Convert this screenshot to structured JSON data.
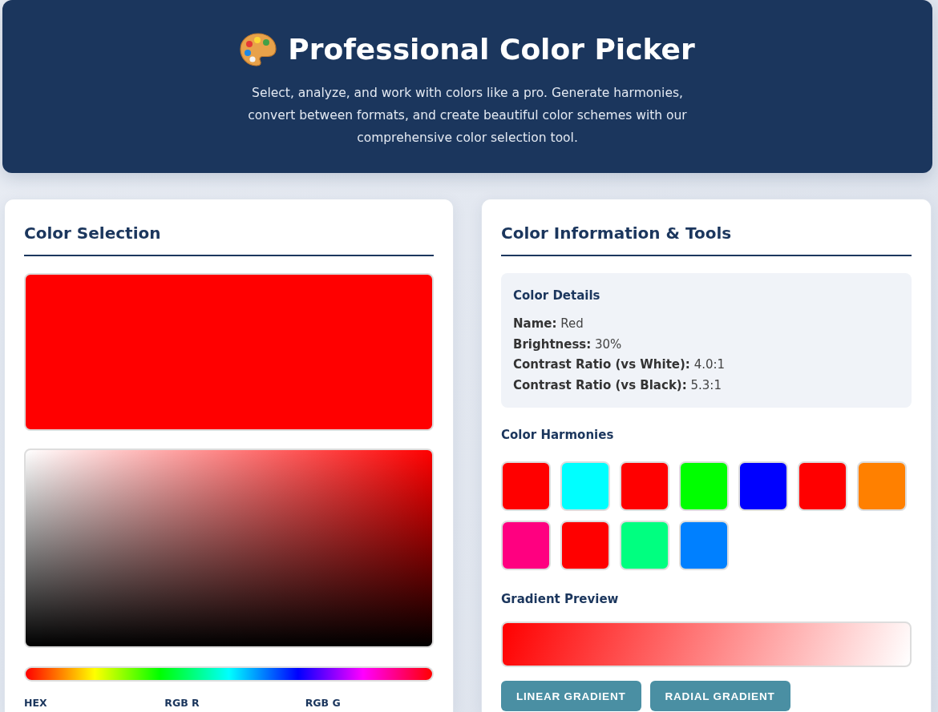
{
  "header": {
    "title": "Professional Color Picker",
    "subtitle": "Select, analyze, and work with colors like a pro. Generate harmonies, convert between formats, and create beautiful color schemes with our comprehensive color selection tool."
  },
  "selection_panel": {
    "title": "Color Selection",
    "preview": {
      "color": "#ff0000"
    },
    "input_labels": [
      "HEX",
      "RGB R",
      "RGB G"
    ]
  },
  "tools_panel": {
    "title": "Color Information & Tools",
    "details": {
      "title": "Color Details",
      "lines": [
        "**Name:** Red",
        "**Brightness:** 30%",
        "**Contrast Ratio (vs White):** 4.0:1",
        "**Contrast Ratio (vs Black):** 5.3:1"
      ]
    },
    "harmonies": {
      "title": "Color Harmonies",
      "swatches": [
        {
          "color": "#ff0000"
        },
        {
          "color": "#00ffff"
        },
        {
          "color": "#ff0000"
        },
        {
          "color": "#00ff00"
        },
        {
          "color": "#0000ff"
        },
        {
          "color": "#ff0000"
        },
        {
          "color": "#ff8000"
        },
        {
          "color": "#ff0080"
        },
        {
          "color": "#ff0000"
        },
        {
          "color": "#00ff80"
        },
        {
          "color": "#0080ff"
        }
      ]
    },
    "gradient": {
      "title": "Gradient Preview",
      "buttons": [
        "LINEAR GRADIENT",
        "RADIAL GRADIENT"
      ]
    }
  }
}
